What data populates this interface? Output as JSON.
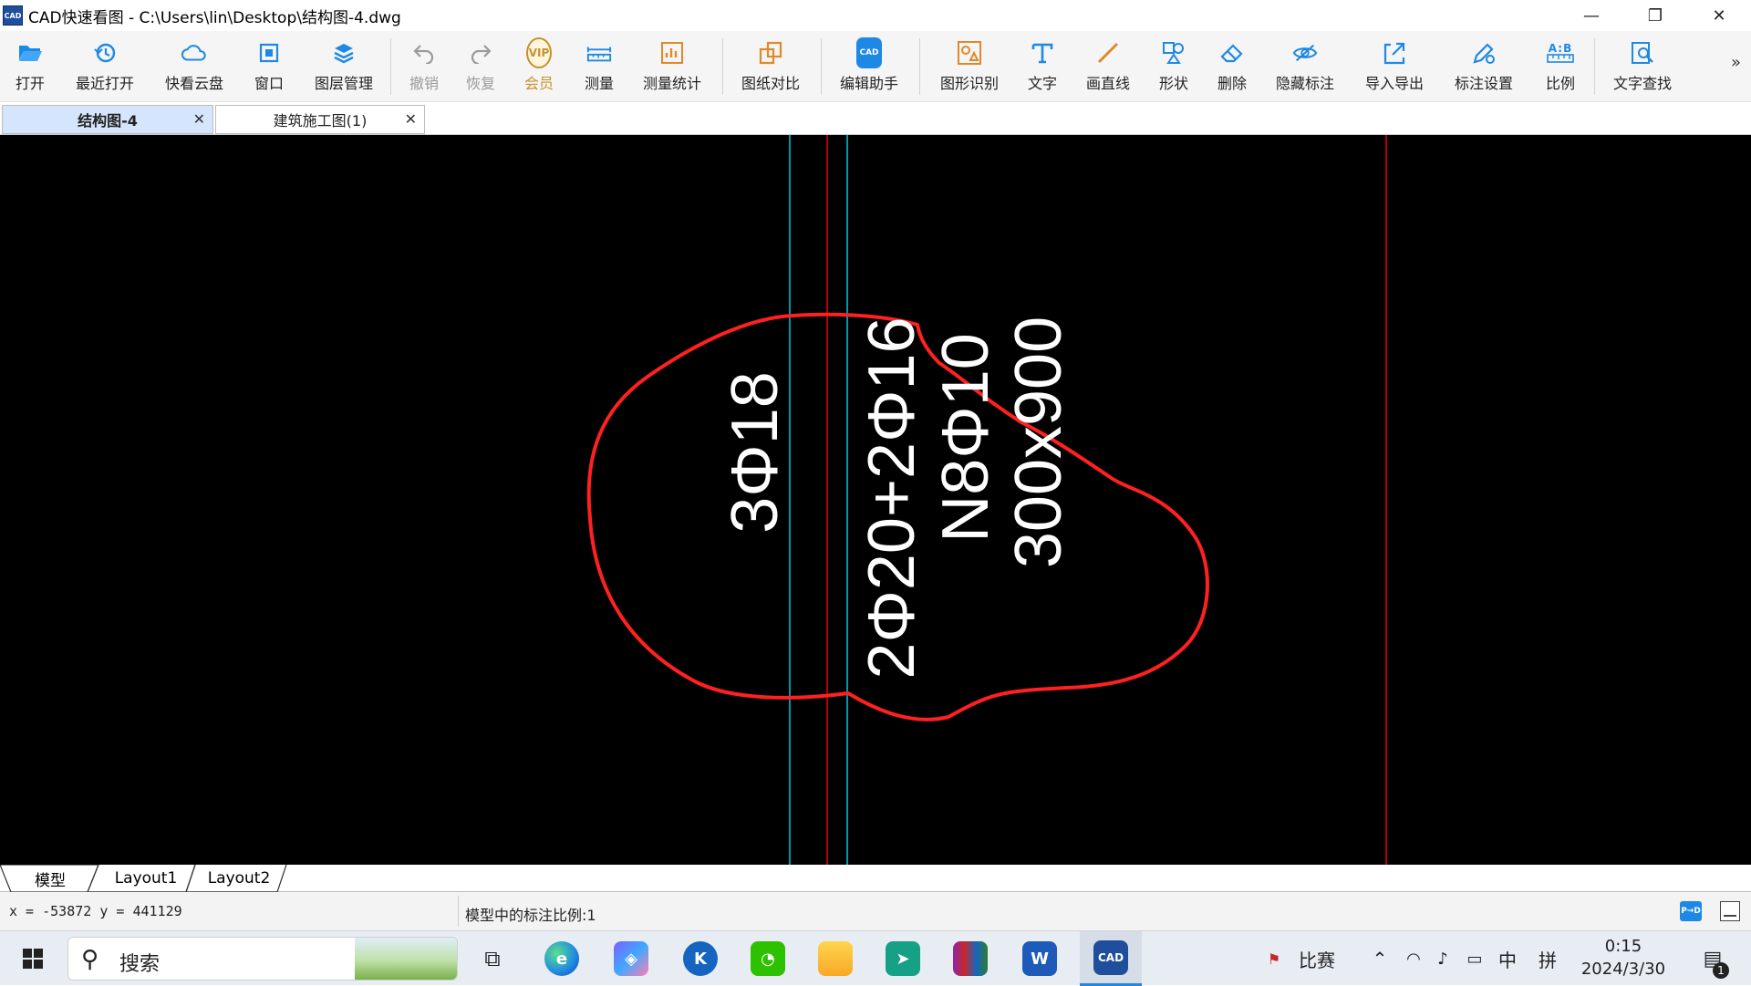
{
  "window": {
    "title": "CAD快速看图 - C:\\Users\\lin\\Desktop\\结构图-4.dwg",
    "logo_text": "CAD",
    "minimize": "—",
    "restore": "❐",
    "close": "✕"
  },
  "toolbar": {
    "items": [
      {
        "label": "打开",
        "icon": "folder-open-icon"
      },
      {
        "label": "最近打开",
        "icon": "history-icon"
      },
      {
        "label": "快看云盘",
        "icon": "cloud-icon"
      },
      {
        "label": "窗口",
        "icon": "window-icon"
      },
      {
        "label": "图层管理",
        "icon": "layers-icon"
      },
      {
        "label": "撤销",
        "icon": "undo-icon"
      },
      {
        "label": "恢复",
        "icon": "redo-icon"
      },
      {
        "label": "会员",
        "icon": "vip-icon",
        "badge": "VIP"
      },
      {
        "label": "测量",
        "icon": "ruler-icon"
      },
      {
        "label": "测量统计",
        "icon": "measure-stats-icon"
      },
      {
        "label": "图纸对比",
        "icon": "compare-icon"
      },
      {
        "label": "编辑助手",
        "icon": "edit-assistant-icon"
      },
      {
        "label": "图形识别",
        "icon": "shape-recognize-icon"
      },
      {
        "label": "文字",
        "icon": "text-icon"
      },
      {
        "label": "画直线",
        "icon": "line-icon"
      },
      {
        "label": "形状",
        "icon": "shapes-icon"
      },
      {
        "label": "删除",
        "icon": "eraser-icon"
      },
      {
        "label": "隐藏标注",
        "icon": "eye-hide-icon"
      },
      {
        "label": "导入导出",
        "icon": "import-export-icon"
      },
      {
        "label": "标注设置",
        "icon": "annotation-settings-icon"
      },
      {
        "label": "比例",
        "icon": "scale-icon",
        "badge": "A:B"
      },
      {
        "label": "文字查找",
        "icon": "text-search-icon"
      }
    ],
    "overflow": "»"
  },
  "tabs": [
    {
      "label": "结构图-4",
      "active": true
    },
    {
      "label": "建筑施工图(1)",
      "active": false
    }
  ],
  "tab_close": "✕",
  "drawing": {
    "annotations": [
      "3Φ18",
      "2Φ20+2Φ16",
      "N8Φ10",
      "300x900"
    ],
    "colors": {
      "background": "#000000",
      "cyan_line": "#00bcd4",
      "red_line": "#e00000",
      "text": "#ffffff",
      "cloud": "#ff2020"
    }
  },
  "layout_tabs": [
    "模型",
    "Layout1",
    "Layout2"
  ],
  "status": {
    "coords": "x = -53872  y = 441129",
    "scale": "模型中的标注比例:1"
  },
  "taskbar": {
    "search_placeholder": "搜索",
    "tray_weather": "比赛",
    "ime_lang": "中",
    "ime_mode": "拼",
    "time": "0:15",
    "date": "2024/3/30",
    "notification_count": "1"
  }
}
